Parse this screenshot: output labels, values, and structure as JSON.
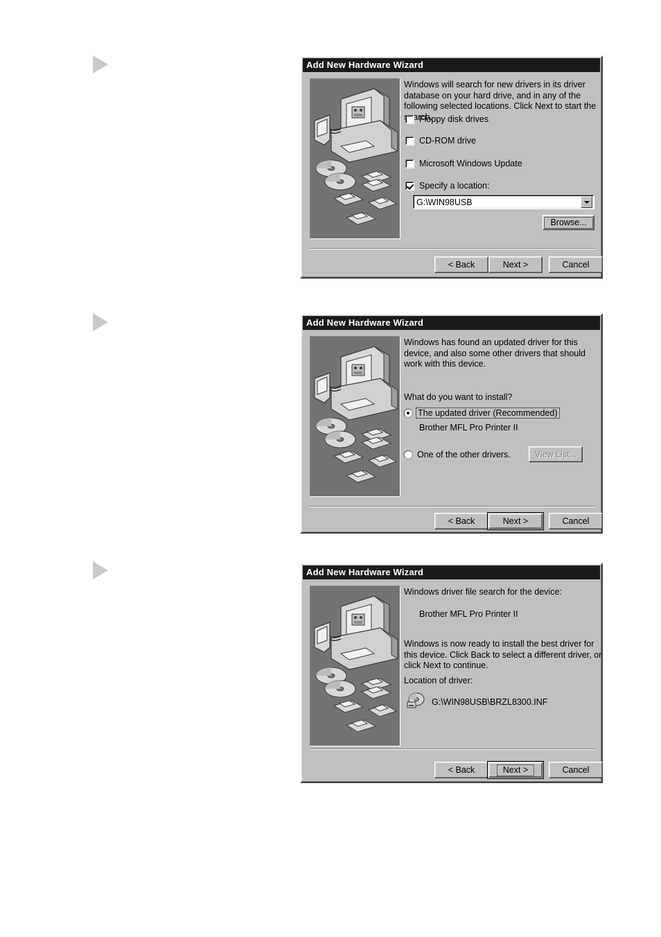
{
  "page": {
    "background": "#ffffff",
    "dialog_face": "#c0c0c0",
    "titlebar_color": "#1a1a1a",
    "illustration_panel_color": "#737373"
  },
  "markers": [
    {
      "name": "step-marker-1"
    },
    {
      "name": "step-marker-2"
    },
    {
      "name": "step-marker-3"
    }
  ],
  "dialogs": [
    {
      "title": "Add New Hardware Wizard",
      "body_text": "Windows will search for new drivers in its driver database on your hard drive, and in any of the following selected locations. Click Next to start the search.",
      "checkboxes": [
        {
          "label": "Floppy disk drives",
          "accel": "F",
          "checked": false
        },
        {
          "label": "CD-ROM drive",
          "accel": "C",
          "checked": false
        },
        {
          "label": "Microsoft Windows Update",
          "accel": "M",
          "checked": false
        },
        {
          "label": "Specify a location:",
          "accel": "l",
          "checked": true
        }
      ],
      "location_combo": {
        "value": "G:\\WIN98USB",
        "arrow_icon": "chevron-down-icon"
      },
      "browse_button": "Browse...",
      "browse_accel": "B",
      "buttons": [
        {
          "label": "< Back",
          "accel": "B",
          "default": false,
          "focused": false
        },
        {
          "label": "Next >",
          "accel": "N",
          "default": false,
          "focused": false
        },
        {
          "label": "Cancel",
          "accel": "",
          "default": false,
          "focused": false
        }
      ]
    },
    {
      "title": "Add New Hardware Wizard",
      "body_text": "Windows has found an updated driver for this device, and also some other drivers that should work with this device.",
      "question": "What do you want to install?",
      "radios": [
        {
          "label": "The updated driver (Recommended)",
          "accel": "T",
          "selected": true,
          "focused": true,
          "sublabel": "Brother MFL Pro Printer II"
        },
        {
          "label": "One of the other drivers.",
          "accel": "O",
          "selected": false,
          "focused": false,
          "sublabel": ""
        }
      ],
      "view_list_button": {
        "label": "View List...",
        "accel": "V",
        "disabled": true
      },
      "buttons": [
        {
          "label": "< Back",
          "accel": "B",
          "default": false,
          "focused": false
        },
        {
          "label": "Next >",
          "accel": "N",
          "default": true,
          "focused": false
        },
        {
          "label": "Cancel",
          "accel": "",
          "default": false,
          "focused": false
        }
      ]
    },
    {
      "title": "Add New Hardware Wizard",
      "search_heading": "Windows driver file search for the device:",
      "device_name": "Brother MFL Pro Printer II",
      "ready_text": "Windows is now ready to install the best driver for this device. Click Back to select a different driver, or click Next to continue.",
      "location_heading": "Location of driver:",
      "driver_icon": "cdrom-drive-icon",
      "driver_path": "G:\\WIN98USB\\BRZL8300.INF",
      "buttons": [
        {
          "label": "< Back",
          "accel": "B",
          "default": false,
          "focused": false
        },
        {
          "label": "Next >",
          "accel": "N",
          "default": true,
          "focused": true
        },
        {
          "label": "Cancel",
          "accel": "",
          "default": false,
          "focused": false
        }
      ]
    }
  ]
}
